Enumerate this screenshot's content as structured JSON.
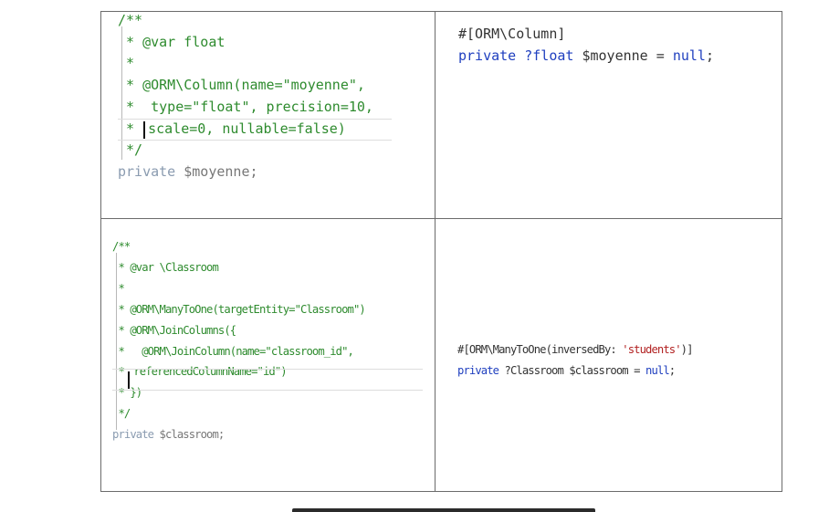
{
  "cell_top_left": {
    "lines": [
      "/**",
      " * @var float",
      " *",
      " * @ORM\\Column(name=\"moyenne\",",
      " *  type=\"float\", precision=10,",
      " * ",
      " */"
    ],
    "line6_rest": "scale=0, nullable=false)",
    "private_kw": "private",
    "property": " $moyenne;"
  },
  "cell_top_right": {
    "attribute": "#[ORM\\Column]",
    "private_kw": "private",
    "type": " ?float",
    "property": " $moyenne = ",
    "null_kw": "null",
    "end": ";"
  },
  "cell_bottom_left": {
    "lines": [
      "/**",
      " * @var \\Classroom",
      " *",
      " * @ORM\\ManyToOne(targetEntity=\"Classroom\")",
      " * @ORM\\JoinColumns({",
      " *   @ORM\\JoinColumn(name=\"classroom_id\",",
      " * ",
      " * })",
      " */"
    ],
    "line7_rest": "referencedColumnName=\"id\")",
    "private_kw": "private",
    "property": " $classroom;"
  },
  "cell_bottom_right": {
    "attr_open": "#[ORM\\ManyToOne(inversedBy: ",
    "attr_string": "'students'",
    "attr_close": ")]",
    "private_kw": "private",
    "type": " ?Classroom",
    "property": " $classroom = ",
    "null_kw": "null",
    "end": ";"
  }
}
